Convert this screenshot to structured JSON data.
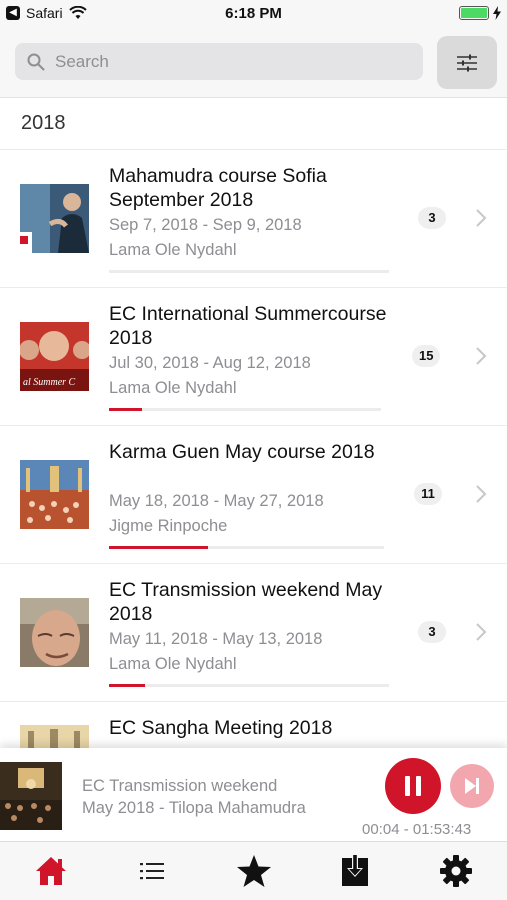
{
  "statusbar": {
    "back_app": "Safari",
    "time": "6:18 PM"
  },
  "search": {
    "placeholder": "Search"
  },
  "section": {
    "year": "2018"
  },
  "courses": [
    {
      "title": "Mahamudra course Sofia September 2018",
      "dates": "Sep 7, 2018 - Sep 9, 2018",
      "teacher": "Lama Ole Nydahl",
      "count": "3",
      "progress": 0.0
    },
    {
      "title": "EC International Summercourse 2018",
      "dates": "Jul 30, 2018 - Aug 12, 2018",
      "teacher": "Lama Ole Nydahl",
      "count": "15",
      "progress": 0.12
    },
    {
      "title": "Karma Guen May course 2018",
      "dates": "May 18, 2018 - May 27, 2018",
      "teacher": "Jigme Rinpoche",
      "count": "11",
      "progress": 0.36
    },
    {
      "title": "EC Transmission weekend May 2018",
      "dates": "May 11, 2018 - May 13, 2018",
      "teacher": "Lama Ole Nydahl",
      "count": "3",
      "progress": 0.13
    },
    {
      "title": "EC Sangha Meeting 2018"
    }
  ],
  "player": {
    "title": "EC Transmission weekend",
    "subtitle": "May 2018 - Tilopa Mahamudra",
    "time": "00:04 - 01:53:43"
  },
  "tabs": [
    {
      "icon": "home-icon",
      "active": true
    },
    {
      "icon": "list-icon",
      "active": false
    },
    {
      "icon": "star-icon",
      "active": false
    },
    {
      "icon": "download-icon",
      "active": false
    },
    {
      "icon": "gear-icon",
      "active": false
    }
  ],
  "colors": {
    "accent": "#d0142a",
    "accent_light": "#f2a6ae",
    "secondary_text": "#8e8e93"
  }
}
